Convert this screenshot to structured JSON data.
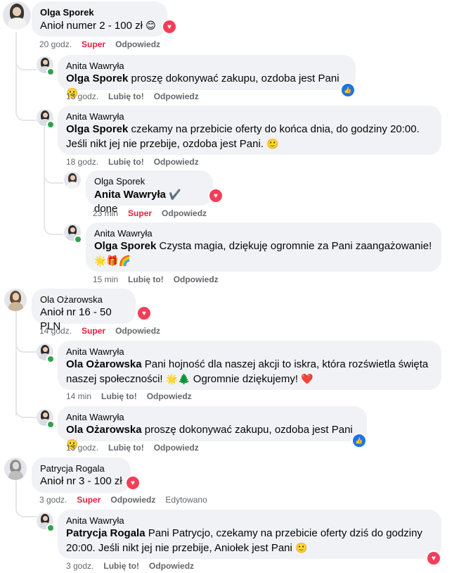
{
  "reactions": {
    "heart": "♥",
    "like": "👍"
  },
  "actions": {
    "like": "Lubię to!",
    "reply": "Odpowiedz",
    "super": "Super",
    "edited": "Edytowano"
  },
  "comments": [
    {
      "author": "Olga Sporek",
      "text": "Anioł numer 2 - 100 zł",
      "emoji": "😊",
      "time": "20 godz."
    },
    {
      "author": "Anita Wawryła",
      "mention": "Olga Sporek",
      "text": " proszę dokonywać zakupu, ozdoba jest Pani",
      "emoji": "🙂",
      "time": "13 godz."
    },
    {
      "author": "Anita Wawryła",
      "mention": "Olga Sporek",
      "text": " czekamy na przebicie oferty do końca dnia, do godziny 20:00.",
      "text2": "Jeśli nikt jej nie przebije, ozdoba jest Pani.",
      "emoji": "🙂",
      "time": "18 godz."
    },
    {
      "author": "Olga Sporek",
      "mention": "Anita Wawryła",
      "text": " done",
      "emoji": "✔️",
      "time": "23 min"
    },
    {
      "author": "Anita Wawryła",
      "mention": "Olga Sporek",
      "text": " Czysta magia, dziękuję ogromnie za Pani zaangażowanie!",
      "emoji": "🌟🎁🌈",
      "time": "15 min"
    },
    {
      "author": "Ola Ożarowska",
      "text": "Anioł nr 16 - 50 PLN",
      "time": "14 godz."
    },
    {
      "author": "Anita Wawryła",
      "mention": "Ola Ożarowska",
      "text": " Pani hojność dla naszej akcji to iskra, która rozświetla święta",
      "text2": "naszej społeczności!",
      "emoji": "🌟🌲",
      "text3": " Ogromnie dziękujemy!",
      "emoji2": "❤️",
      "time": "14 min"
    },
    {
      "author": "Anita Wawryła",
      "mention": "Ola Ożarowska",
      "text": " proszę dokonywać zakupu, ozdoba jest Pani",
      "emoji": "🙂",
      "time": "13 godz."
    },
    {
      "author": "Patrycja Rogala",
      "text": "Anioł nr 3 - 100 zł",
      "time": "3 godz."
    },
    {
      "author": "Anita Wawryła",
      "mention": "Patrycja Rogala",
      "text": " Pani Patrycjo, czekamy na przebicie oferty dziś do godziny",
      "text2": "20:00. Jeśli nikt jej nie przebije, Aniołek jest Pani",
      "emoji": "🙂",
      "time": "3 godz."
    }
  ]
}
